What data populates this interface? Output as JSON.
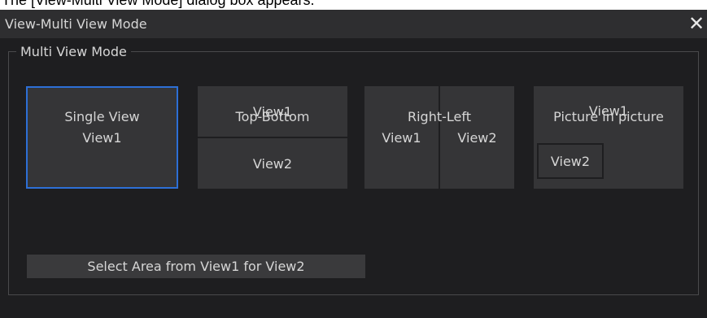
{
  "caption": "The [View-Multi View Mode] dialog box appears.",
  "dialog": {
    "title": "View-Multi View Mode",
    "close_glyph": "✕"
  },
  "group": {
    "label": "Multi View Mode"
  },
  "modes": {
    "single": {
      "label": "Single View",
      "pane1": "View1",
      "selected": true
    },
    "top_bottom": {
      "label": "Top-Bottom",
      "pane1": "View1",
      "pane2": "View2"
    },
    "right_left": {
      "label": "Right-Left",
      "pane1": "View1",
      "pane2": "View2"
    },
    "pip": {
      "label": "Picture in picture",
      "pane1": "View1",
      "pane2": "View2"
    }
  },
  "area_button_label": "Select Area from View1 for View2",
  "colors": {
    "dialog_bg": "#1e1e20",
    "titlebar_bg": "#2e2e30",
    "pane_bg": "#353537",
    "selected_border": "#2d6fd6",
    "text": "#d6d6d6"
  },
  "icons": {
    "close": "close-icon"
  }
}
